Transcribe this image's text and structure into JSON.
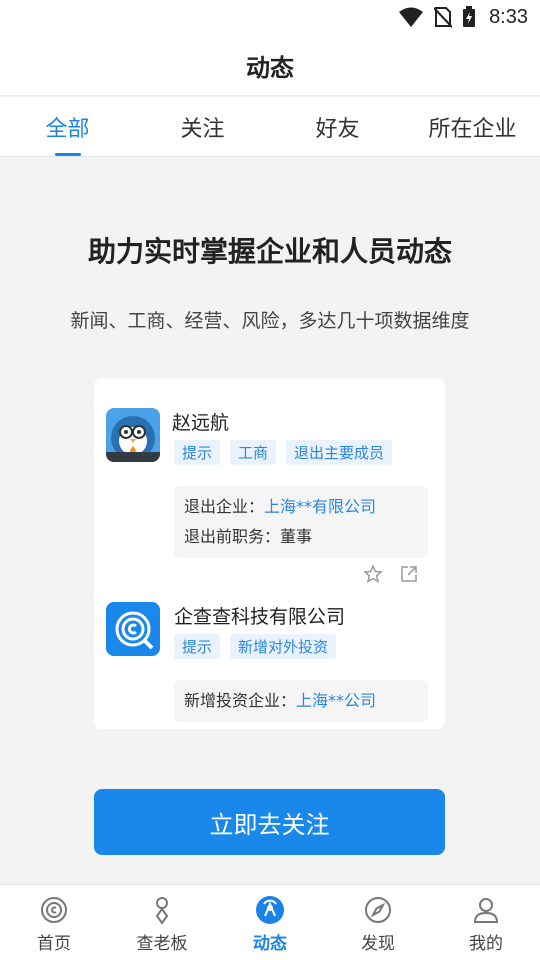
{
  "status": {
    "time": "8:33"
  },
  "header": {
    "title": "动态"
  },
  "tabs": [
    {
      "label": "全部",
      "active": true
    },
    {
      "label": "关注",
      "active": false
    },
    {
      "label": "好友",
      "active": false
    },
    {
      "label": "所在企业",
      "active": false
    }
  ],
  "promo": {
    "headline": "助力实时掌握企业和人员动态",
    "subline": "新闻、工商、经营、风险，多达几十项数据维度"
  },
  "feed": [
    {
      "name": "赵远航",
      "tags": [
        "提示",
        "工商",
        "退出主要成员"
      ],
      "info": [
        {
          "label": "退出企业：",
          "value": "上海**有限公司"
        },
        {
          "label": "退出前职务：",
          "value": "董事"
        }
      ]
    },
    {
      "name": "企查查科技有限公司",
      "tags": [
        "提示",
        "新增对外投资"
      ],
      "info": [
        {
          "label": "新增投资企业：",
          "value": "上海**公司"
        }
      ]
    }
  ],
  "cta": {
    "label": "立即去关注"
  },
  "bottom_nav": [
    {
      "label": "首页",
      "icon": "home-logo-icon",
      "active": false
    },
    {
      "label": "查老板",
      "icon": "boss-icon",
      "active": false
    },
    {
      "label": "动态",
      "icon": "news-feed-icon",
      "active": true
    },
    {
      "label": "发现",
      "icon": "compass-icon",
      "active": false
    },
    {
      "label": "我的",
      "icon": "profile-icon",
      "active": false
    }
  ],
  "colors": {
    "accent": "#1a84e6",
    "tag_bg": "#e9f2fd",
    "cta_bg": "#1a88ea",
    "page_bg": "#f3f3f3"
  }
}
